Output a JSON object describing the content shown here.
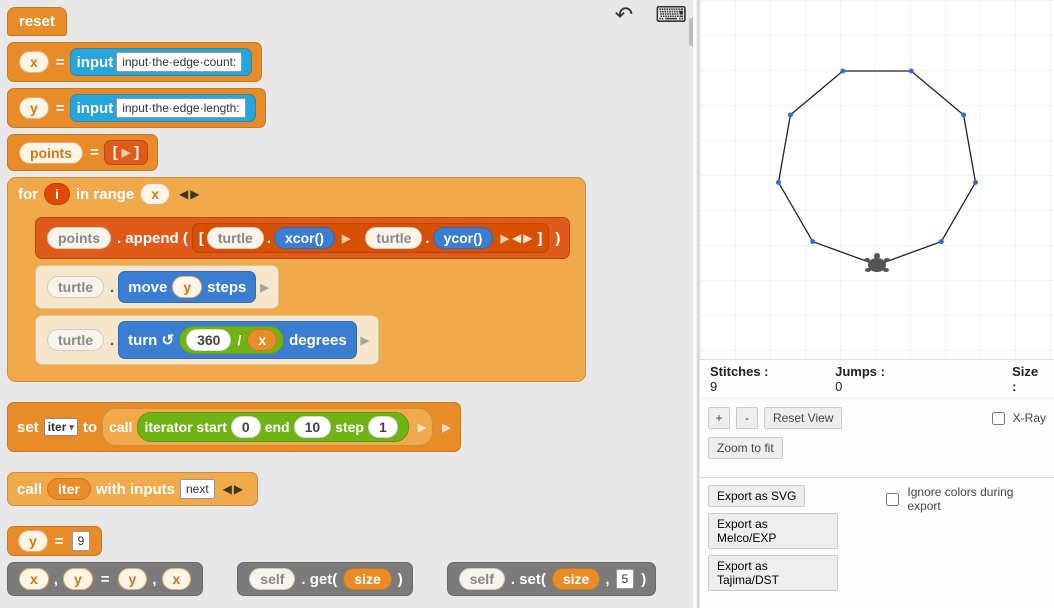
{
  "blocks": {
    "reset": "reset",
    "x": "x",
    "y": "y",
    "eq": "=",
    "input": "input",
    "input1_prompt": "input·the·edge·count:",
    "input2_prompt": "input·the·edge·length:",
    "points": "points",
    "empty_list_open": "[",
    "empty_list_close": "]",
    "for": "for",
    "i": "i",
    "in_range": "in range",
    "append": ". append (",
    "append_close": ")",
    "bracket_open": "[",
    "bracket_close": "]",
    "turtle": "turtle",
    "dot": ".",
    "comma": ",",
    "xcor": "xcor()",
    "ycor": "ycor()",
    "move": "move",
    "steps": "steps",
    "turn": "turn ↺",
    "n360": "360",
    "slash": "/",
    "degrees": "degrees",
    "set": "set",
    "iter": "iter",
    "to": "to",
    "call": "call",
    "iterator_start": "iterator start",
    "start_v": "0",
    "end": "end",
    "end_v": "10",
    "step": "step",
    "step_v": "1",
    "with_inputs": "with inputs",
    "next": "next",
    "nine": "9",
    "self": "self",
    "get": ". get(",
    "close_paren": ")",
    "setm": ". set(",
    "size": "size",
    "five": "5"
  },
  "right": {
    "stitches_label": "Stitches :",
    "stitches_value": "9",
    "jumps_label": "Jumps :",
    "jumps_value": "0",
    "size_label": "Size :",
    "plus": "+",
    "minus": "-",
    "reset_view": "Reset View",
    "zoom_fit": "Zoom to fit",
    "xray": "X-Ray",
    "ignore": "Ignore colors during export",
    "exp_svg": "Export as SVG",
    "exp_melco": "Export as Melco/EXP",
    "exp_tajima": "Export as Tajima/DST"
  },
  "chart_data": {
    "type": "line",
    "title": "9-sided polygon path drawn by turtle",
    "series": [
      {
        "name": "polygon",
        "points_count": 9,
        "closed": true
      }
    ],
    "x": [],
    "y": [],
    "description": "Regular nonagon rendered on grid canvas; turtle cursor at bottom vertex."
  }
}
